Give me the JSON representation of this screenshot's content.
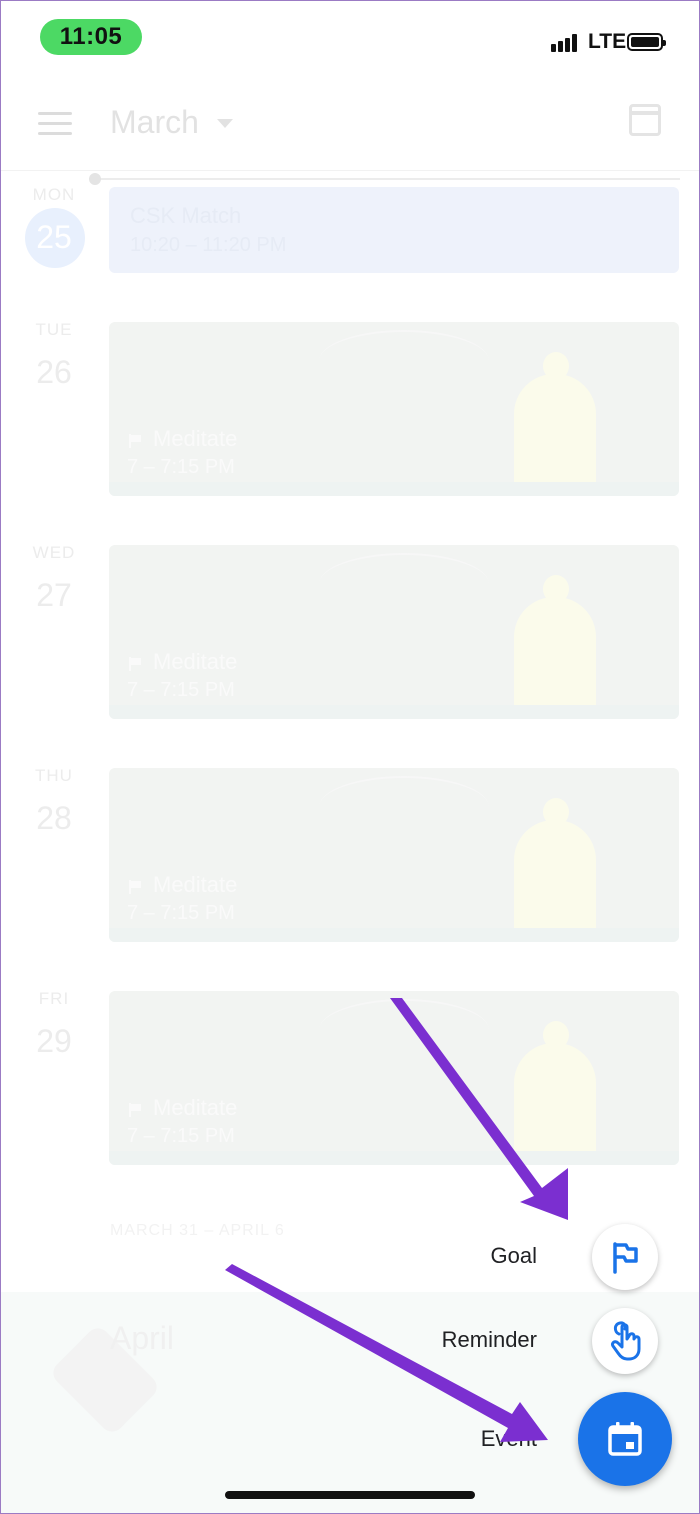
{
  "status_bar": {
    "time": "11:05",
    "network": "LTE"
  },
  "app_bar": {
    "month": "March"
  },
  "events": {
    "csk": {
      "title": "CSK Match",
      "time": "10:20 – 11:20 PM"
    }
  },
  "days": [
    {
      "dow": "MON",
      "num": "25"
    },
    {
      "dow": "TUE",
      "num": "26",
      "title": "Meditate",
      "time": "7 – 7:15 PM"
    },
    {
      "dow": "WED",
      "num": "27",
      "title": "Meditate",
      "time": "7 – 7:15 PM"
    },
    {
      "dow": "THU",
      "num": "28",
      "title": "Meditate",
      "time": "7 – 7:15 PM"
    },
    {
      "dow": "FRI",
      "num": "29",
      "title": "Meditate",
      "time": "7 – 7:15 PM"
    }
  ],
  "week_label": "MARCH 31 – APRIL 6",
  "april_title": "April",
  "fab_menu": {
    "goal_label": "Goal",
    "reminder_label": "Reminder",
    "event_label": "Event"
  },
  "colors": {
    "accent": "#1a73e8",
    "annotation_arrow": "#7b2fd0",
    "time_pill": "#4cd964"
  },
  "icons": [
    "menu-icon",
    "calendar-icon",
    "flag-icon",
    "reminder-hand-icon",
    "event-calendar-icon"
  ]
}
